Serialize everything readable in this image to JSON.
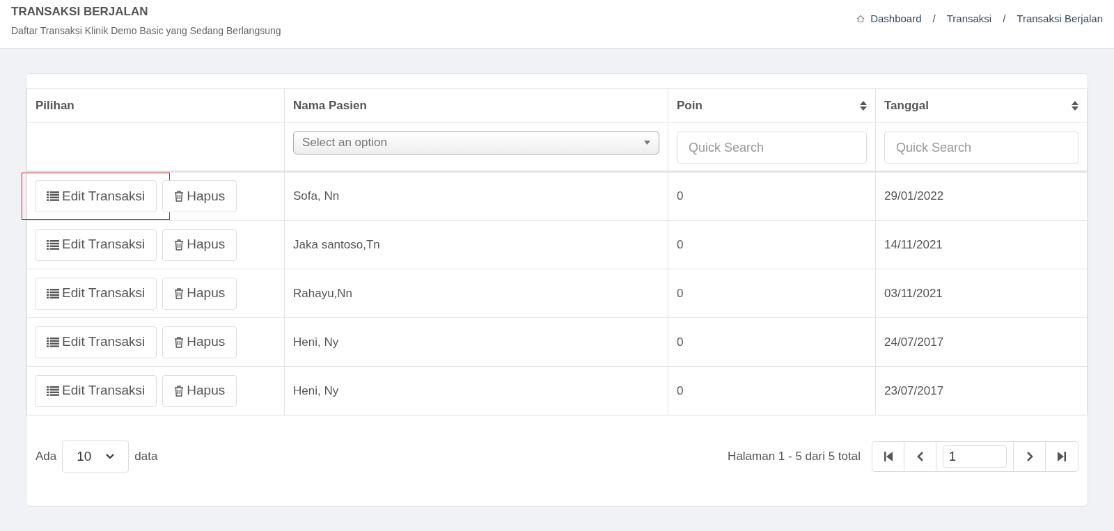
{
  "header": {
    "title": "TRANSAKSI BERJALAN",
    "subtitle": "Daftar Transaksi Klinik Demo Basic yang Sedang Berlangsung"
  },
  "breadcrumb": {
    "separator": "/",
    "items": [
      "Dashboard",
      "Transaksi",
      "Transaksi Berjalan"
    ]
  },
  "table": {
    "columns": [
      {
        "label": "Pilihan",
        "sortable": false
      },
      {
        "label": "Nama Pasien",
        "sortable": false
      },
      {
        "label": "Poin",
        "sortable": true
      },
      {
        "label": "Tanggal",
        "sortable": true
      }
    ],
    "filters": [
      {
        "kind": "none"
      },
      {
        "kind": "select",
        "placeholder": "Select an option"
      },
      {
        "kind": "text",
        "placeholder": "Quick Search"
      },
      {
        "kind": "text",
        "placeholder": "Quick Search"
      }
    ],
    "rows": [
      {
        "edit": "Edit Transaksi",
        "delete": "Hapus",
        "highlighted": true,
        "name": "Sofa, Nn",
        "poin": "0",
        "tanggal": "29/01/2022"
      },
      {
        "edit": "Edit Transaksi",
        "delete": "Hapus",
        "highlighted": false,
        "name": "Jaka santoso,Tn",
        "poin": "0",
        "tanggal": "14/11/2021"
      },
      {
        "edit": "Edit Transaksi",
        "delete": "Hapus",
        "highlighted": false,
        "name": "Rahayu,Nn",
        "poin": "0",
        "tanggal": "03/11/2021"
      },
      {
        "edit": "Edit Transaksi",
        "delete": "Hapus",
        "highlighted": false,
        "name": "Heni, Ny",
        "poin": "0",
        "tanggal": "24/07/2017"
      },
      {
        "edit": "Edit Transaksi",
        "delete": "Hapus",
        "highlighted": false,
        "name": "Heni, Ny",
        "poin": "0",
        "tanggal": "23/07/2017"
      }
    ]
  },
  "footer": {
    "prefix": "Ada",
    "page_size": "10",
    "suffix": "data",
    "summary": "Halaman 1 - 5 dari 5 total",
    "page": "1"
  }
}
